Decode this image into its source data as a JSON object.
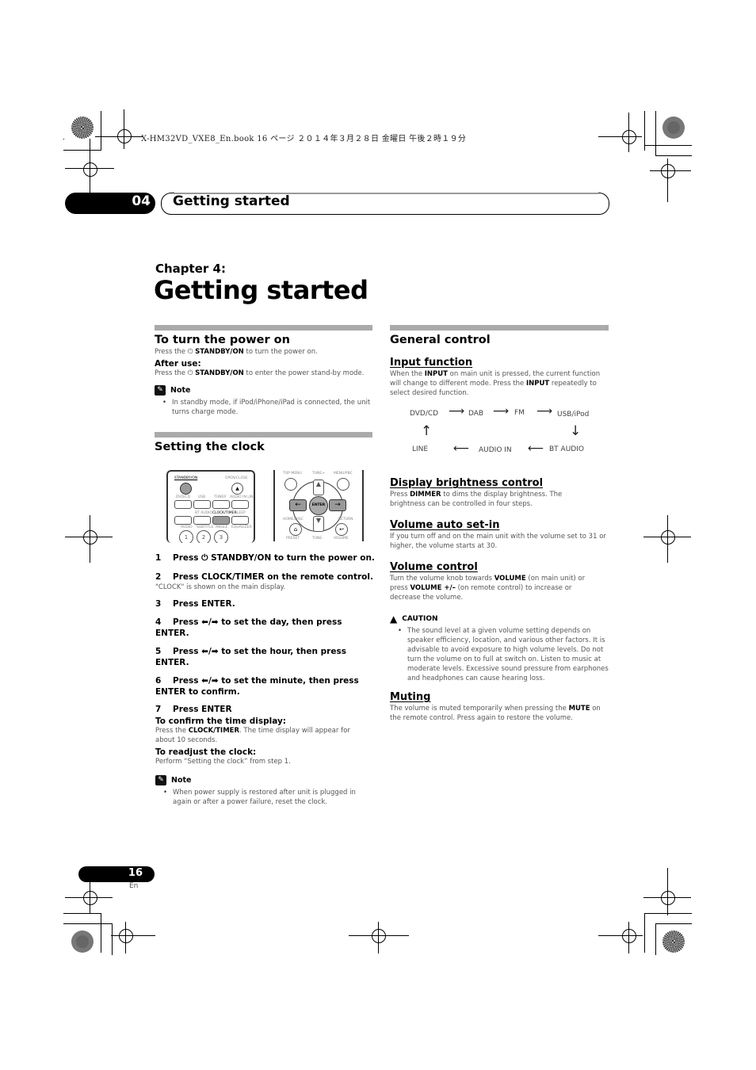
{
  "print_header": "X-HM32VD_VXE8_En.book  16 ページ  ２０１４年３月２８日  金曜日  午後２時１９分",
  "chapter_tab": {
    "number": "04",
    "title": "Getting started"
  },
  "chapter": {
    "label": "Chapter 4:",
    "title": "Getting started"
  },
  "left": {
    "power": {
      "heading": "To turn the power on",
      "text_pre": "Press the ",
      "standby_icon": "power-icon",
      "text_bold": "STANDBY/ON",
      "text_post": " to turn the power on.",
      "after_use_heading": "After use:",
      "after_pre": "Press the ",
      "after_bold": "STANDBY/ON",
      "after_post": " to enter the power stand-by mode.",
      "note_label": "Note",
      "note_items": [
        "In standby mode, if iPod/iPhone/iPad is connected, the unit turns charge mode."
      ]
    },
    "clock": {
      "heading": "Setting the clock",
      "remote_left": {
        "labels": [
          "STANDBY/ON",
          "OPEN/CLOSE",
          "DVD/CD",
          "USB",
          "TUNER",
          "AUDIO IN LINE",
          "BT AUDIO",
          "CLOCK/TIMER",
          "SLEEP",
          "AUDIO",
          "SUBTITLE",
          "ANGLE",
          "EQUALIZER",
          "1",
          "2",
          "3"
        ]
      },
      "remote_right": {
        "labels": [
          "TOP MENU",
          "TUNE+",
          "MENU/PBC",
          "ENTER",
          "HOME/DISC",
          "RETURN",
          "PRESET",
          "TUNE-",
          "VOLUME"
        ]
      },
      "steps": [
        {
          "num": "1",
          "text": "Press ⏻ STANDBY/ON to turn the power on."
        },
        {
          "num": "2",
          "text": "Press CLOCK/TIMER on the remote control.",
          "sub": "\"CLOCK\" is shown on the main display."
        },
        {
          "num": "3",
          "text": "Press ENTER."
        },
        {
          "num": "4",
          "text": "Press ⬅/➡ to set the day, then press ENTER."
        },
        {
          "num": "5",
          "text": "Press ⬅/➡ to set the hour, then press ENTER."
        },
        {
          "num": "6",
          "text": "Press ⬅/➡ to set the minute, then press ENTER to confirm."
        },
        {
          "num": "7",
          "text": "Press ENTER"
        }
      ],
      "confirm_heading": "To confirm the time display:",
      "confirm_pre": "Press the ",
      "confirm_bold": "CLOCK/TIMER",
      "confirm_post": ". The time display will appear for about 10 seconds.",
      "readjust_heading": "To readjust the clock:",
      "readjust_text": "Perform “Setting the clock” from step 1.",
      "note_label": "Note",
      "note_items": [
        "When power supply is restored after unit is plugged in again or after a power failure, reset the clock."
      ]
    }
  },
  "right": {
    "heading": "General control",
    "input": {
      "heading": "Input function",
      "t1": "When the ",
      "b1": "INPUT",
      "t2": " on main unit is pressed, the current function will change to different mode. Press the ",
      "b2": "INPUT",
      "t3": " repeatedly to select desired function.",
      "flow": {
        "top": [
          "DVD/CD",
          "DAB",
          "FM",
          "USB/iPod"
        ],
        "bottom": [
          "LINE",
          "AUDIO IN",
          "BT AUDIO"
        ],
        "arrow_right": "⟶",
        "arrow_left": "⟵",
        "arrow_up": "↑",
        "arrow_down": "↓"
      }
    },
    "brightness": {
      "heading": "Display brightness control",
      "t1": "Press ",
      "b1": "DIMMER",
      "t2": " to dims the display brightness. The brightness can be controlled in four steps."
    },
    "auto_set": {
      "heading": "Volume auto set-in",
      "text": "If you turn off and on the main unit with the volume set to 31 or higher, the volume starts at 30."
    },
    "volume": {
      "heading": "Volume control",
      "t1": "Turn the volume knob towards ",
      "b1": "VOLUME",
      "t2": " (on main unit) or press ",
      "b2": "VOLUME +/–",
      "t3": " (on remote control) to increase or decrease the volume."
    },
    "caution": {
      "label": "CAUTION",
      "items": [
        "The sound level at a given volume setting depends on speaker efficiency, location, and various other factors. It is advisable to avoid exposure to high volume levels. Do not turn the volume on to full at switch on. Listen to music at moderate levels. Excessive sound pressure from earphones and headphones can cause hearing loss."
      ]
    },
    "muting": {
      "heading": "Muting",
      "t1": "The volume is muted temporarily when pressing the ",
      "b1": "MUTE",
      "t2": " on the remote control. Press again to restore the volume."
    }
  },
  "footer": {
    "page": "16",
    "lang": "En"
  }
}
